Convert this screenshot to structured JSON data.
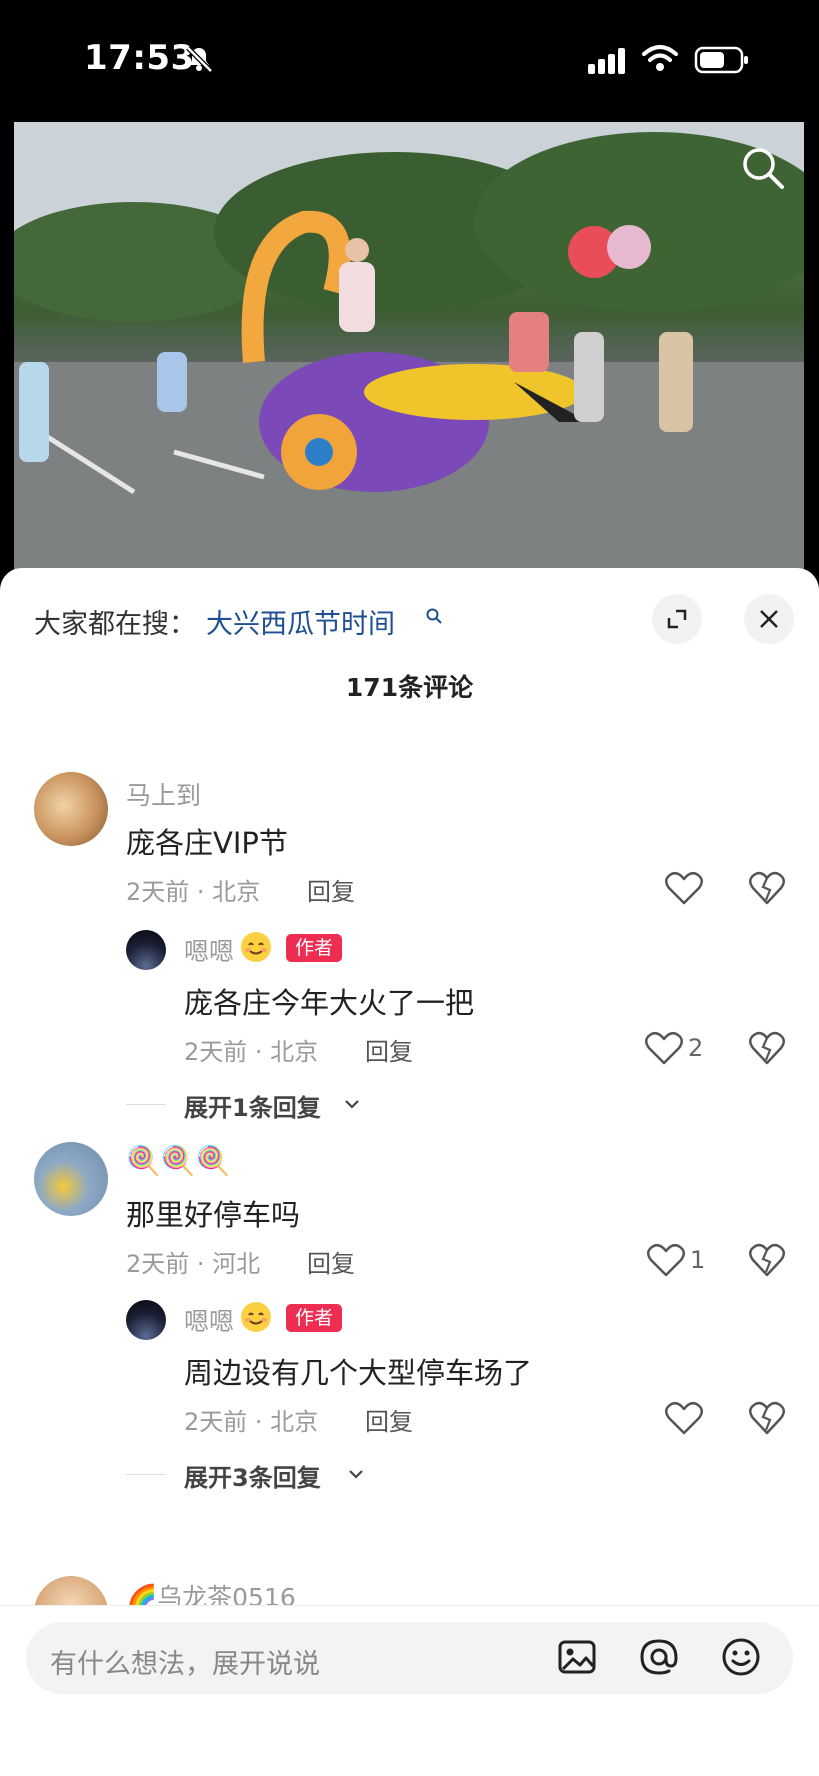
{
  "status_bar": {
    "time": "17:53"
  },
  "hot_search": {
    "label": "大家都在搜：",
    "term": "大兴西瓜节时间"
  },
  "comments_header": {
    "count_text": "171条评论"
  },
  "comments": [
    {
      "username": "马上到",
      "text": "庞各庄VIP节",
      "meta": "2天前 · 北京",
      "reply_label": "回复",
      "likes": "",
      "reply": {
        "username": "嗯嗯",
        "author_tag": "作者",
        "text": "庞各庄今年大火了一把",
        "meta": "2天前 · 北京",
        "reply_label": "回复",
        "likes": "2"
      },
      "expand_text": "展开1条回复"
    },
    {
      "username": "🍭🍭🍭",
      "text": "那里好停车吗",
      "meta": "2天前 · 河北",
      "reply_label": "回复",
      "likes": "1",
      "reply": {
        "username": "嗯嗯",
        "author_tag": "作者",
        "text": "周边设有几个大型停车场了",
        "meta": "2天前 · 北京",
        "reply_label": "回复",
        "likes": ""
      },
      "expand_text": "展开3条回复"
    },
    {
      "username": "🌈乌龙茶0516"
    }
  ],
  "input_bar": {
    "placeholder": "有什么想法，展开说说"
  },
  "colors": {
    "author_tag": "#ee2d53",
    "hot_link": "#1d4f91"
  },
  "icons": [
    "bell-off-icon",
    "signal-icon",
    "wifi-icon",
    "battery-icon",
    "search-icon",
    "expand-icon",
    "close-icon",
    "heart-icon",
    "broken-heart-icon",
    "image-icon",
    "at-icon",
    "emoji-icon"
  ]
}
